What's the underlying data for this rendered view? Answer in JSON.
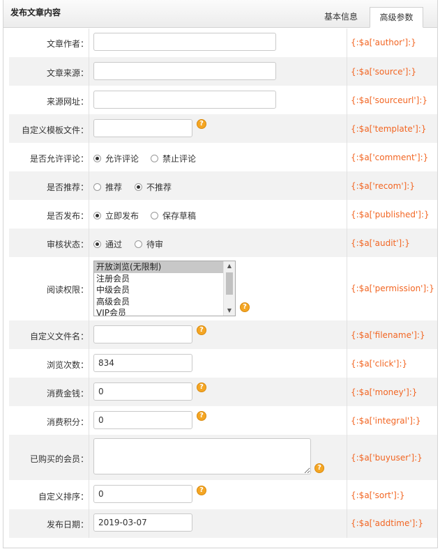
{
  "panel": {
    "title": "发布文章内容"
  },
  "tabs": [
    {
      "label": "基本信息"
    },
    {
      "label": "高级参数"
    }
  ],
  "fields": {
    "author": {
      "label": "文章作者：",
      "value": "",
      "tag": "{:$a['author']:}"
    },
    "source": {
      "label": "文章来源：",
      "value": "",
      "tag": "{:$a['source']:}"
    },
    "sourceurl": {
      "label": "来源网址：",
      "value": "",
      "tag": "{:$a['sourceurl']:}"
    },
    "template": {
      "label": "自定义模板文件：",
      "value": "",
      "tag": "{:$a['template']:}"
    },
    "comment": {
      "label": "是否允许评论：",
      "options": [
        "允许评论",
        "禁止评论"
      ],
      "selected": 0,
      "tag": "{:$a['comment']:}"
    },
    "recom": {
      "label": "是否推荐：",
      "options": [
        "推荐",
        "不推荐"
      ],
      "selected": 1,
      "tag": "{:$a['recom']:}"
    },
    "published": {
      "label": "是否发布：",
      "options": [
        "立即发布",
        "保存草稿"
      ],
      "selected": 0,
      "tag": "{:$a['published']:}"
    },
    "audit": {
      "label": "审核状态：",
      "options": [
        "通过",
        "待审"
      ],
      "selected": 0,
      "tag": "{:$a['audit']:}"
    },
    "permission": {
      "label": "阅读权限：",
      "options": [
        "开放浏览(无限制)",
        "注册会员",
        "中级会员",
        "高级会员",
        "VIP会员"
      ],
      "selected": 0,
      "tag": "{:$a['permission']:}"
    },
    "filename": {
      "label": "自定义文件名：",
      "value": "",
      "tag": "{:$a['filename']:}"
    },
    "click": {
      "label": "浏览次数：",
      "value": "834",
      "tag": "{:$a['click']:}"
    },
    "money": {
      "label": "消费金钱：",
      "value": "0",
      "tag": "{:$a['money']:}"
    },
    "integral": {
      "label": "消费积分：",
      "value": "0",
      "tag": "{:$a['integral']:}"
    },
    "buyuser": {
      "label": "已购买的会员：",
      "value": "",
      "tag": "{:$a['buyuser']:}"
    },
    "sort": {
      "label": "自定义排序：",
      "value": "0",
      "tag": "{:$a['sort']:}"
    },
    "addtime": {
      "label": "发布日期：",
      "value": "2019-03-07",
      "tag": "{:$a['addtime']:}"
    }
  },
  "help_glyph": "?",
  "colors": {
    "tag": "#f26522",
    "help": "#f5a623",
    "row_alt": "#f2f2f2"
  }
}
